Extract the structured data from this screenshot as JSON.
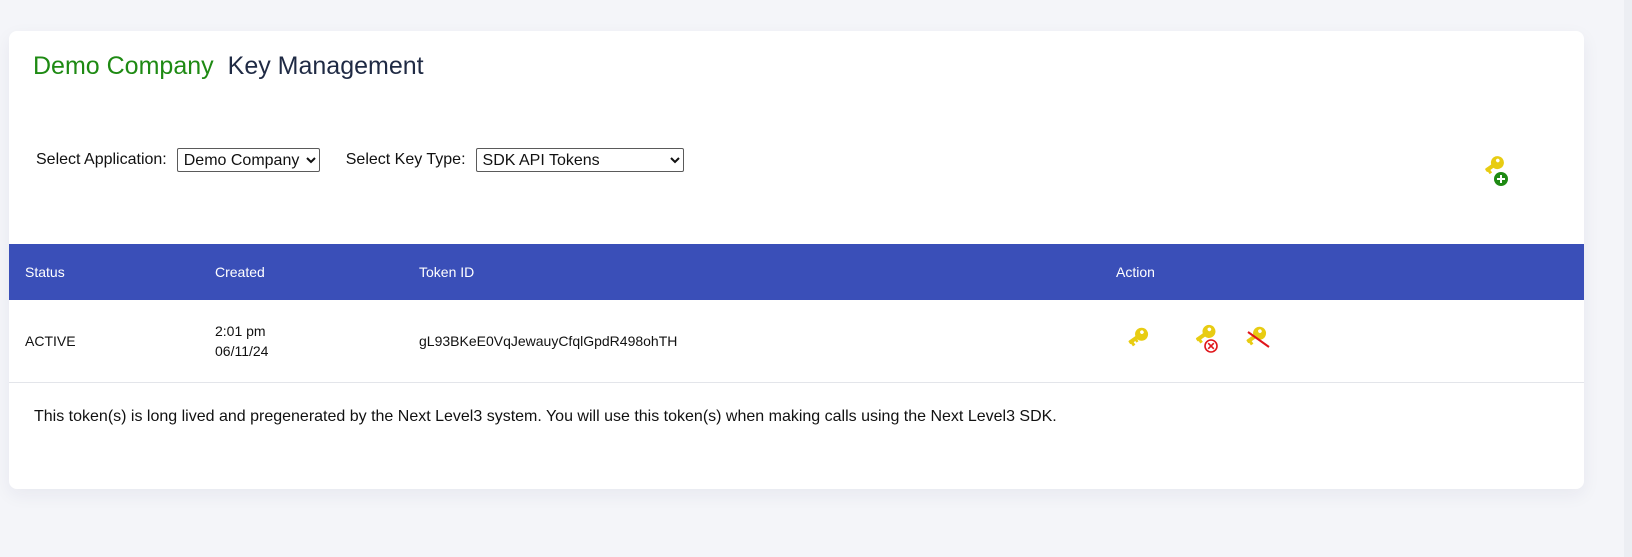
{
  "header": {
    "company": "Demo Company",
    "section": "Key Management"
  },
  "filters": {
    "application_label": "Select Application:",
    "application_value": "Demo Company",
    "key_type_label": "Select Key Type:",
    "key_type_value": "SDK API Tokens"
  },
  "icons": {
    "add": "key-add-icon",
    "view": "key-icon",
    "revoke": "key-revoke-icon",
    "disable": "key-disable-icon"
  },
  "table": {
    "columns": [
      "Status",
      "Created",
      "Token ID",
      "Action"
    ],
    "rows": [
      {
        "status": "ACTIVE",
        "created_time": "2:01 pm",
        "created_date": "06/11/24",
        "token_id": "gL93BKeE0VqJewauyCfqlGpdR498ohTH"
      }
    ]
  },
  "note": "This token(s) is long lived and pregenerated by the Next Level3 system. You will use this token(s) when making calls using the Next Level3 SDK.",
  "colors": {
    "accent_green": "#1e8a13",
    "header_blue": "#3a4fb8",
    "key_yellow": "#e8cc12",
    "revoke_red": "#e0161b"
  }
}
